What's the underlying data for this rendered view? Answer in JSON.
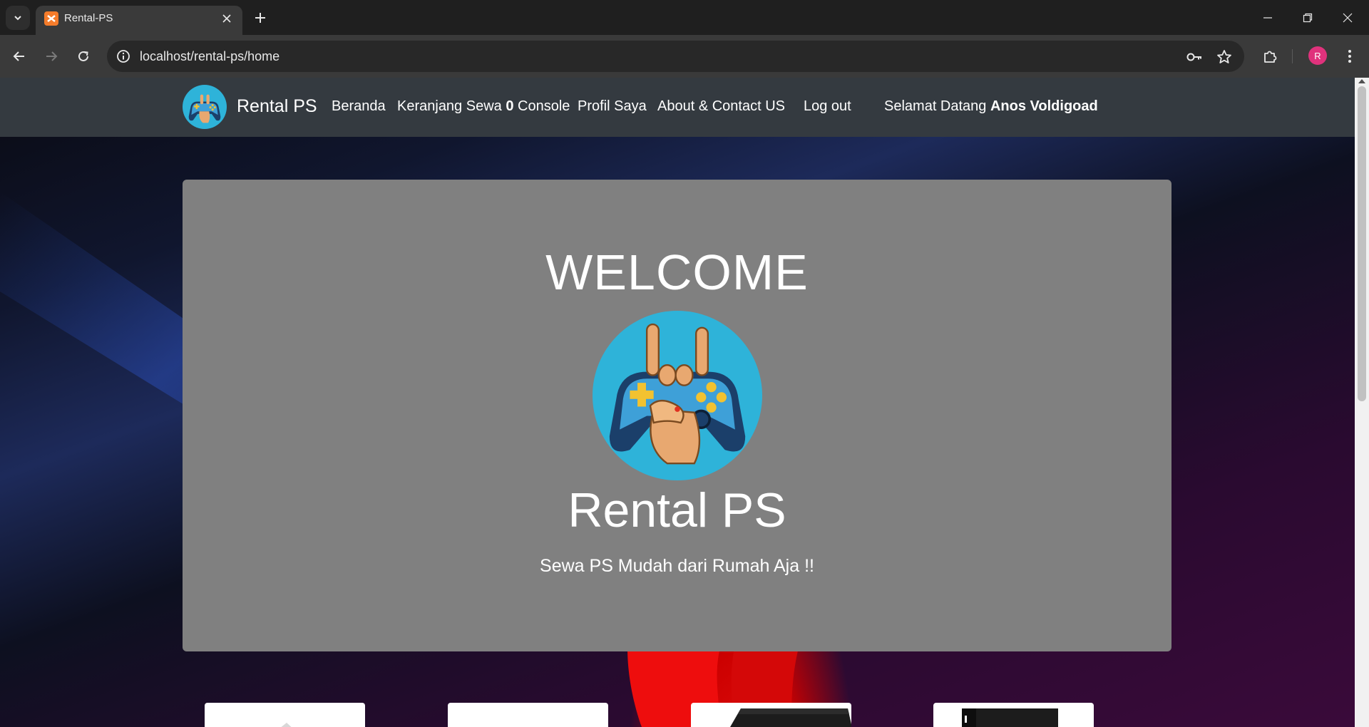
{
  "browser": {
    "tab_title": "Rental-PS",
    "url": "localhost/rental-ps/home",
    "profile_initial": "R"
  },
  "site": {
    "brand": "Rental PS",
    "nav": {
      "home": "Beranda",
      "cart_prefix": "Keranjang Sewa ",
      "cart_count": "0",
      "cart_suffix": " Console",
      "profile": "Profil Saya",
      "about": "About & Contact US",
      "logout": "Log out",
      "welcome_prefix": "Selamat Datang ",
      "user_name": "Anos Voldigoad"
    },
    "jumbotron": {
      "title": "WELCOME",
      "brand": "Rental PS",
      "tagline": "Sewa PS Mudah dari Rumah Aja !!"
    }
  },
  "colors": {
    "navbar_bg": "#343a40",
    "jumbotron_bg": "#808080",
    "logo_circle": "#2eb3d9",
    "tab_favicon": "#f57c2b",
    "profile_avatar": "#e0327c"
  },
  "icons": {
    "tab_list": "chevron-down-icon",
    "tab_close": "close-icon",
    "new_tab": "plus-icon",
    "back": "arrow-left-icon",
    "forward": "arrow-right-icon",
    "reload": "reload-icon",
    "site_info": "info-icon",
    "password": "key-icon",
    "bookmark": "star-icon",
    "extensions": "puzzle-icon",
    "menu": "kebab-menu-icon"
  }
}
